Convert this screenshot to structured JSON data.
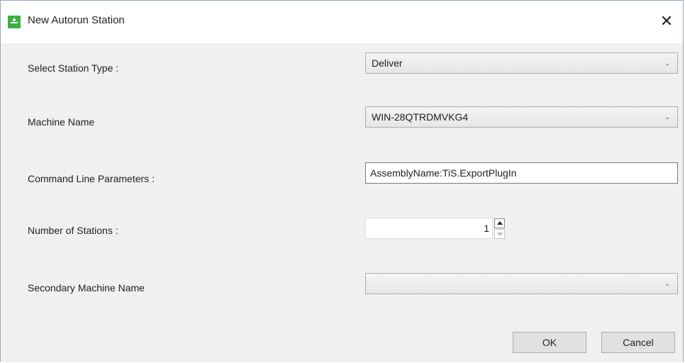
{
  "window": {
    "title": "New Autorun Station",
    "close_glyph": "✕",
    "icon": "app-icon"
  },
  "form": {
    "station_type": {
      "label": "Select Station Type :",
      "value": "Deliver"
    },
    "machine_name": {
      "label": "Machine Name",
      "value": "WIN-28QTRDMVKG4"
    },
    "command_line": {
      "label": "Command Line Parameters :",
      "value": "AssemblyName:TiS.ExportPlugIn"
    },
    "num_stations": {
      "label": "Number of Stations :",
      "value": "1"
    },
    "secondary_machine": {
      "label": "Secondary Machine Name",
      "value": ""
    }
  },
  "buttons": {
    "ok": "OK",
    "cancel": "Cancel"
  },
  "colors": {
    "icon_green": "#3cb043",
    "dialog_bg": "#f0f0f0",
    "border": "#8fa9c9"
  }
}
